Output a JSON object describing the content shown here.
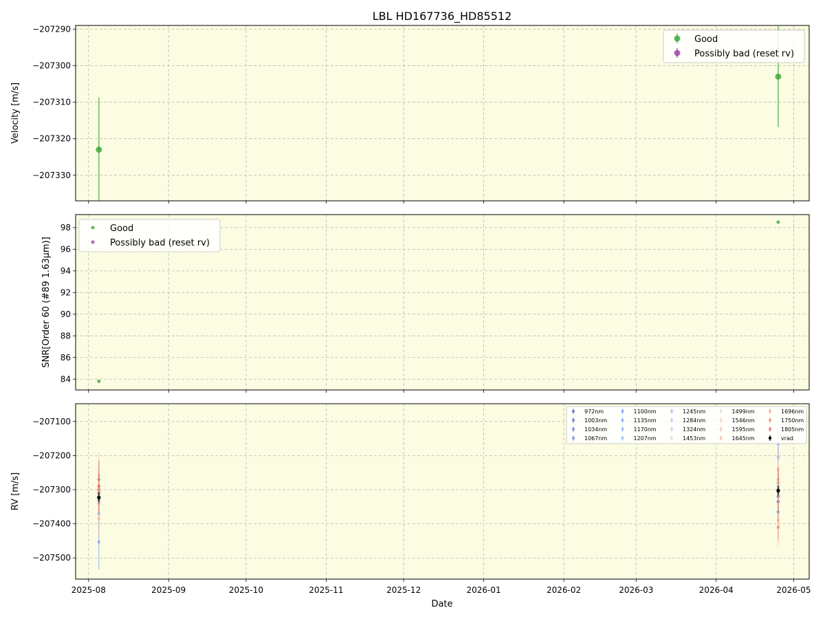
{
  "figure": {
    "title": "LBL HD167736_HD85512",
    "xlabel": "Date",
    "x_ticks": [
      "2025-08",
      "2025-09",
      "2025-10",
      "2025-11",
      "2025-12",
      "2026-01",
      "2026-02",
      "2026-03",
      "2026-04",
      "2026-05"
    ],
    "x_tick_dates": [
      "2025-08-01",
      "2025-09-01",
      "2025-10-01",
      "2025-11-01",
      "2025-12-01",
      "2026-01-01",
      "2026-02-01",
      "2026-03-01",
      "2026-04-01",
      "2026-05-01"
    ],
    "x_range": [
      "2025-07-27",
      "2026-05-07"
    ],
    "background": "#fcfce2",
    "grid": true
  },
  "legend_labels": {
    "good": "Good",
    "bad": "Possibly bad (reset rv)"
  },
  "colors": {
    "good": "#2ca02c",
    "bad": "#9b30a8",
    "vrad": "#000000"
  },
  "chart_data": [
    {
      "type": "scatter",
      "ylabel": "Velocity [m/s]",
      "ylim": [
        -207337,
        -207289
      ],
      "y_ticks": [
        -207290,
        -207300,
        -207310,
        -207320,
        -207330
      ],
      "y_tick_labels": [
        "−207290",
        "−207300",
        "−207310",
        "−207320",
        "−207330"
      ],
      "legend": "top-right",
      "series": [
        {
          "name": "Good",
          "points": [
            {
              "x": "2025-08-05",
              "y": -207323,
              "err": 14.3
            },
            {
              "x": "2026-04-25",
              "y": -207303,
              "err": 13.8
            }
          ]
        },
        {
          "name": "Possibly bad (reset rv)",
          "points": []
        }
      ]
    },
    {
      "type": "scatter",
      "ylabel": "SNR[Order 60 (#89 1.63μm)]",
      "ylim": [
        83,
        99.2
      ],
      "y_ticks": [
        84,
        86,
        88,
        90,
        92,
        94,
        96,
        98
      ],
      "y_tick_labels": [
        "84",
        "86",
        "88",
        "90",
        "92",
        "94",
        "96",
        "98"
      ],
      "legend": "top-left",
      "series": [
        {
          "name": "Good",
          "points": [
            {
              "x": "2025-08-05",
              "y": 83.8
            },
            {
              "x": "2026-04-25",
              "y": 98.5
            }
          ]
        },
        {
          "name": "Possibly bad (reset rv)",
          "points": []
        }
      ]
    },
    {
      "type": "scatter",
      "ylabel": "RV [m/s]",
      "ylim": [
        -207562,
        -207048
      ],
      "y_ticks": [
        -207100,
        -207200,
        -207300,
        -207400,
        -207500
      ],
      "y_tick_labels": [
        "−207100",
        "−207200",
        "−207300",
        "−207400",
        "−207500"
      ],
      "legend": "top-right",
      "series": [
        {
          "name": "972nm",
          "color": "#3b4cc0",
          "points": [
            {
              "x": "2025-08-05",
              "y": -207330,
              "err": 20
            },
            {
              "x": "2026-04-25",
              "y": -207320,
              "err": 20
            }
          ]
        },
        {
          "name": "1003nm",
          "color": "#4358cb",
          "points": [
            {
              "x": "2025-08-05",
              "y": -207310,
              "err": 25
            },
            {
              "x": "2026-04-25",
              "y": -207335,
              "err": 25
            }
          ]
        },
        {
          "name": "1034nm",
          "color": "#4f69d9",
          "points": [
            {
              "x": "2025-08-05",
              "y": -207300,
              "err": 25
            },
            {
              "x": "2026-04-25",
              "y": -207365,
              "err": 25
            }
          ]
        },
        {
          "name": "1067nm",
          "color": "#5a78e4",
          "points": [
            {
              "x": "2025-08-05",
              "y": -207270,
              "err": 30
            },
            {
              "x": "2026-04-25",
              "y": -207300,
              "err": 30
            }
          ]
        },
        {
          "name": "1100nm",
          "color": "#6788ee",
          "points": [
            {
              "x": "2025-08-05",
              "y": -207320,
              "err": 35
            },
            {
              "x": "2026-04-25",
              "y": -207280,
              "err": 35
            }
          ]
        },
        {
          "name": "1135nm",
          "color": "#7396f5",
          "points": [
            {
              "x": "2025-08-05",
              "y": -207453,
              "err": 80
            },
            {
              "x": "2026-04-25",
              "y": -207165,
              "err": 50
            }
          ]
        },
        {
          "name": "1170nm",
          "color": "#80a3fa",
          "points": [
            {
              "x": "2025-08-05",
              "y": -207370,
              "err": 45
            },
            {
              "x": "2026-04-25",
              "y": -207290,
              "err": 40
            }
          ]
        },
        {
          "name": "1207nm",
          "color": "#8db0fe",
          "points": [
            {
              "x": "2025-08-05",
              "y": -207340,
              "err": 40
            },
            {
              "x": "2026-04-25",
              "y": -207205,
              "err": 45
            }
          ]
        },
        {
          "name": "1245nm",
          "color": "#9abbff",
          "points": [
            {
              "x": "2025-08-05",
              "y": -207310,
              "err": 35
            },
            {
              "x": "2026-04-25",
              "y": -207280,
              "err": 35
            }
          ]
        },
        {
          "name": "1284nm",
          "color": "#a7c5fe",
          "points": [
            {
              "x": "2025-08-05",
              "y": -207300,
              "err": 30
            },
            {
              "x": "2026-04-25",
              "y": -207310,
              "err": 30
            }
          ]
        },
        {
          "name": "1324nm",
          "color": "#b3cdfb",
          "points": [
            {
              "x": "2025-08-05",
              "y": -207320,
              "err": 30
            },
            {
              "x": "2026-04-25",
              "y": -207300,
              "err": 30
            }
          ]
        },
        {
          "name": "1453nm",
          "color": "#c9d7f0",
          "points": [
            {
              "x": "2025-08-05",
              "y": -207310,
              "err": 35
            },
            {
              "x": "2026-04-25",
              "y": -207290,
              "err": 35
            }
          ]
        },
        {
          "name": "1499nm",
          "color": "#e8d6cc",
          "points": [
            {
              "x": "2025-08-05",
              "y": -207290,
              "err": 35
            },
            {
              "x": "2026-04-25",
              "y": -207310,
              "err": 35
            }
          ]
        },
        {
          "name": "1546nm",
          "color": "#f1cdba",
          "points": [
            {
              "x": "2025-08-05",
              "y": -207330,
              "err": 40
            },
            {
              "x": "2026-04-25",
              "y": -207280,
              "err": 40
            }
          ]
        },
        {
          "name": "1595nm",
          "color": "#f5c0a7",
          "points": [
            {
              "x": "2025-08-05",
              "y": -207260,
              "err": 70
            },
            {
              "x": "2026-04-25",
              "y": -207390,
              "err": 75
            }
          ]
        },
        {
          "name": "1645nm",
          "color": "#f7b194",
          "points": [
            {
              "x": "2025-08-05",
              "y": -207385,
              "err": 50
            },
            {
              "x": "2026-04-25",
              "y": -207240,
              "err": 50
            }
          ]
        },
        {
          "name": "1696nm",
          "color": "#f39f80",
          "points": [
            {
              "x": "2025-08-05",
              "y": -207300,
              "err": 40
            },
            {
              "x": "2026-04-25",
              "y": -207270,
              "err": 40
            }
          ]
        },
        {
          "name": "1750nm",
          "color": "#ea7b60",
          "points": [
            {
              "x": "2025-08-05",
              "y": -207310,
              "err": 60
            },
            {
              "x": "2026-04-25",
              "y": -207410,
              "err": 40
            }
          ]
        },
        {
          "name": "1805nm",
          "color": "#dc5d4a",
          "points": [
            {
              "x": "2025-08-05",
              "y": -207290,
              "err": 75
            },
            {
              "x": "2026-04-25",
              "y": -207300,
              "err": 60
            }
          ]
        },
        {
          "name": "vrad",
          "color": "#000000",
          "points": [
            {
              "x": "2025-08-05",
              "y": -207323,
              "err": 14
            },
            {
              "x": "2026-04-25",
              "y": -207303,
              "err": 14
            }
          ]
        }
      ]
    }
  ]
}
